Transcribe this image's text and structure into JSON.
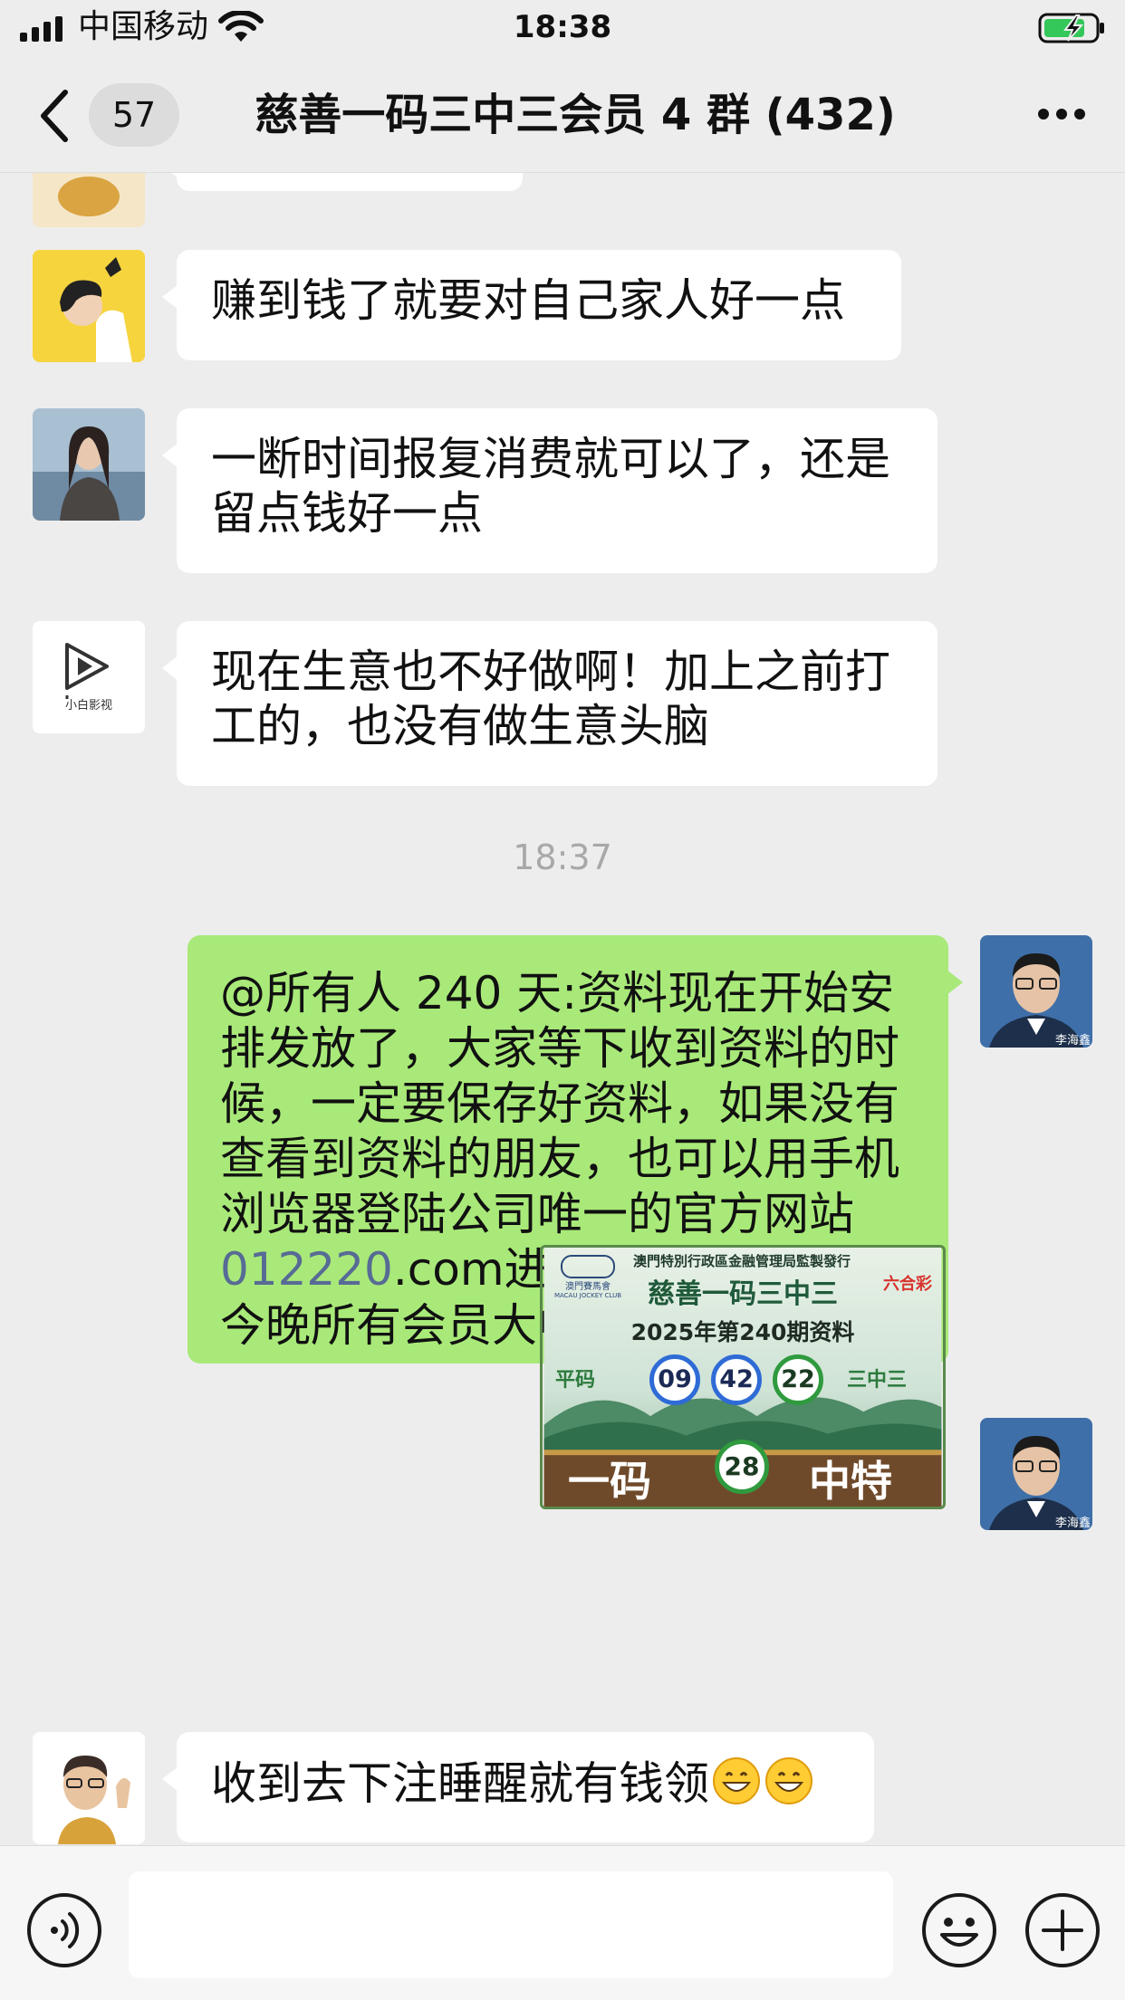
{
  "status_bar": {
    "carrier": "中国移动",
    "time": "18:38"
  },
  "nav": {
    "unread_count": "57",
    "title": "慈善一码三中三会员 4 群 (432)"
  },
  "messages": [
    {
      "text": "赚到钱了就要对自己家人好一点"
    },
    {
      "text": "一断时间报复消费就可以了，还是留点钱好一点"
    },
    {
      "text": "现在生意也不好做啊！加上之前打工的，也没有做生意头脑"
    },
    {
      "timestamp": "18:37"
    },
    {
      "text_before_link": "@所有人 240 天:资料现在开始安排发放了，大家等下收到资料的时候，一定要保存好资料，如果没有查看到资料的朋友，也可以用手机浏览器登陆公司唯一的官方网站",
      "link": "012220",
      "text_after_link": ".com进去查看，在此祝贺今晚所有会员大中"
    },
    {
      "image": {
        "header_small": "澳門特別行政區金融管理局監製發行",
        "logo_text": "澳門賽馬會",
        "logo_sub": "MACAU JOCKEY CLUB",
        "badge": "六合彩",
        "title": "慈善一码三中三",
        "issue": "2025年第240期资料",
        "left_label": "平码",
        "balls": [
          "09",
          "42",
          "22"
        ],
        "right_label": "三中三",
        "bottom_left": "一码",
        "special_ball": "28",
        "bottom_right": "中特"
      }
    },
    {
      "text": "收到去下注睡醒就有钱领"
    }
  ],
  "avatars": {
    "video_channel_label": "小白影视",
    "sender_name_tag": "李海鑫"
  },
  "input": {
    "placeholder": ""
  },
  "colors": {
    "background": "#ededed",
    "my_bubble": "#a9e979",
    "link": "#576b95"
  }
}
